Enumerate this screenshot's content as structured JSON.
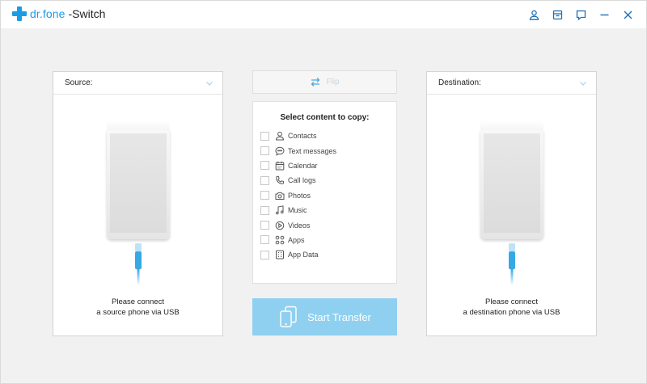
{
  "titlebar": {
    "brand": "dr.fone",
    "product": "-Switch",
    "icons": [
      "user-icon",
      "cart-icon",
      "feedback-icon",
      "minimize-icon",
      "close-icon"
    ]
  },
  "source_panel": {
    "label": "Source:",
    "note_line1": "Please connect",
    "note_line2": "a source phone via USB"
  },
  "destination_panel": {
    "label": "Destination:",
    "note_line1": "Please connect",
    "note_line2": "a destination phone via USB"
  },
  "flip": {
    "label": "Flip"
  },
  "content": {
    "title": "Select content to copy:",
    "items": [
      {
        "label": "Contacts",
        "icon": "contacts-icon",
        "checked": false
      },
      {
        "label": "Text messages",
        "icon": "messages-icon",
        "checked": false
      },
      {
        "label": "Calendar",
        "icon": "calendar-icon",
        "checked": false
      },
      {
        "label": "Call logs",
        "icon": "call-logs-icon",
        "checked": false
      },
      {
        "label": "Photos",
        "icon": "photos-icon",
        "checked": false
      },
      {
        "label": "Music",
        "icon": "music-icon",
        "checked": false
      },
      {
        "label": "Videos",
        "icon": "videos-icon",
        "checked": false
      },
      {
        "label": "Apps",
        "icon": "apps-icon",
        "checked": false
      },
      {
        "label": "App Data",
        "icon": "app-data-icon",
        "checked": false
      }
    ]
  },
  "start_transfer": {
    "label": "Start Transfer"
  },
  "colors": {
    "accent": "#1b9ce6",
    "start_button": "#8fd0f1",
    "background": "#f1f1f1"
  }
}
